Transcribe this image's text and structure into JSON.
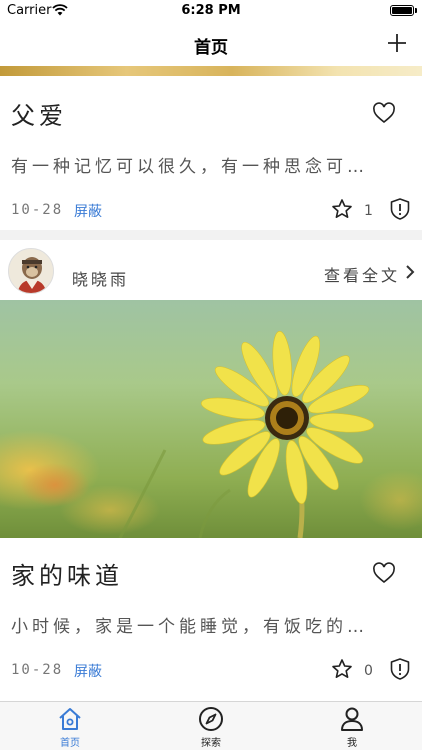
{
  "status_bar": {
    "carrier": "Carrier",
    "time": "6:28 PM",
    "battery_level": 1.0
  },
  "nav": {
    "title": "首页",
    "add_icon": "plus-icon"
  },
  "cards": [
    {
      "title": "父爱",
      "excerpt": "有一种记忆可以很久，有一种思念可…",
      "date": "10-28",
      "block_label": "屏蔽",
      "star_count": "1"
    },
    {
      "author": "晓晓雨",
      "read_all": "查看全文",
      "title": "家的味道",
      "excerpt": "小时候，家是一个能睡觉，有饭吃的…",
      "date": "10-28",
      "block_label": "屏蔽",
      "star_count": "0"
    }
  ],
  "tabs": [
    {
      "label": "首页",
      "icon": "home-icon",
      "active": true
    },
    {
      "label": "探索",
      "icon": "compass-icon",
      "active": false
    },
    {
      "label": "我",
      "icon": "user-icon",
      "active": false
    }
  ],
  "colors": {
    "accent": "#3a7bd5",
    "background": "#f2f2f2"
  }
}
